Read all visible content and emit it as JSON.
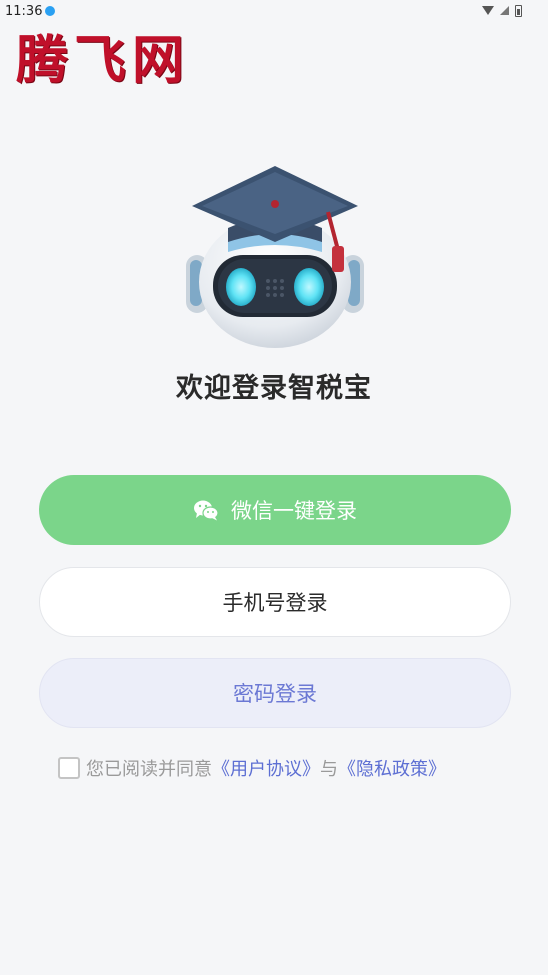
{
  "status_bar": {
    "time": "11:36"
  },
  "watermark": {
    "text": "腾飞网"
  },
  "welcome": {
    "title": "欢迎登录智税宝"
  },
  "buttons": {
    "wechat_label": "微信一键登录",
    "phone_label": "手机号登录",
    "password_label": "密码登录"
  },
  "agreement": {
    "prefix": "您已阅读并同意",
    "user_agreement": "《用户协议》",
    "conjunction": "与",
    "privacy_policy": "《隐私政策》",
    "checked": false
  },
  "colors": {
    "wechat_green": "#7bd58a",
    "password_bg": "#eceef9",
    "link_blue": "#5d6fd3",
    "watermark_red": "#c0102a"
  },
  "icons": [
    "wechat-icon",
    "wifi-icon",
    "signal-icon",
    "battery-icon"
  ]
}
